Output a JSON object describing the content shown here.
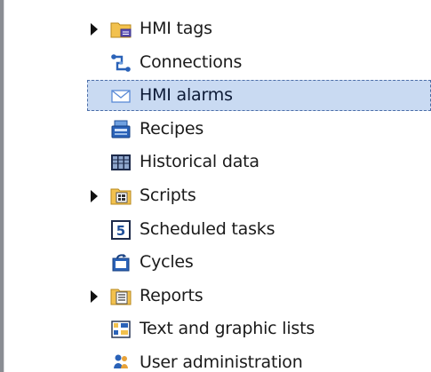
{
  "tree": {
    "items": [
      {
        "label": "HMI tags",
        "icon": "hmi-tags-folder-icon",
        "expandable": true,
        "selected": false
      },
      {
        "label": "Connections",
        "icon": "connections-icon",
        "expandable": false,
        "selected": false
      },
      {
        "label": "HMI alarms",
        "icon": "envelope-icon",
        "expandable": false,
        "selected": true
      },
      {
        "label": "Recipes",
        "icon": "recipes-icon",
        "expandable": false,
        "selected": false
      },
      {
        "label": "Historical data",
        "icon": "historical-data-icon",
        "expandable": false,
        "selected": false
      },
      {
        "label": "Scripts",
        "icon": "scripts-folder-icon",
        "expandable": true,
        "selected": false
      },
      {
        "label": "Scheduled tasks",
        "icon": "scheduled-tasks-icon",
        "expandable": false,
        "selected": false
      },
      {
        "label": "Cycles",
        "icon": "cycles-icon",
        "expandable": false,
        "selected": false
      },
      {
        "label": "Reports",
        "icon": "reports-folder-icon",
        "expandable": true,
        "selected": false
      },
      {
        "label": "Text and graphic lists",
        "icon": "text-graphic-lists-icon",
        "expandable": false,
        "selected": false
      },
      {
        "label": "User administration",
        "icon": "user-administration-icon",
        "expandable": false,
        "selected": false
      }
    ]
  },
  "colors": {
    "selection_fill": "#c9daf2",
    "selection_border": "#4c6ea8",
    "folder": "#f2c14e",
    "accent_blue": "#2a62b8"
  }
}
